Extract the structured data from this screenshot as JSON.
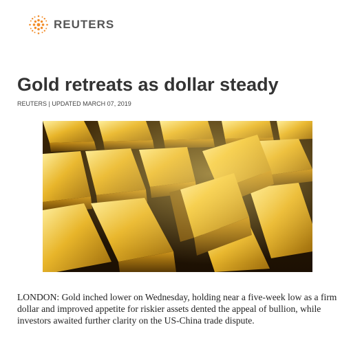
{
  "brand": {
    "name": "REUTERS",
    "logo_icon": "reuters-dot-logo-icon",
    "accent_color": "#f28c28"
  },
  "article": {
    "headline": "Gold retreats as dollar steady",
    "byline": "REUTERS | UPDATED MARCH 07, 2019",
    "image_icon": "gold-bars-photo",
    "body": "LONDON: Gold inched lower on Wednesday, holding near a five-week low as a firm dollar and improved appetite for riskier assets dented the appeal of bullion, while investors awaited further clarity on the US-China trade dispute."
  }
}
